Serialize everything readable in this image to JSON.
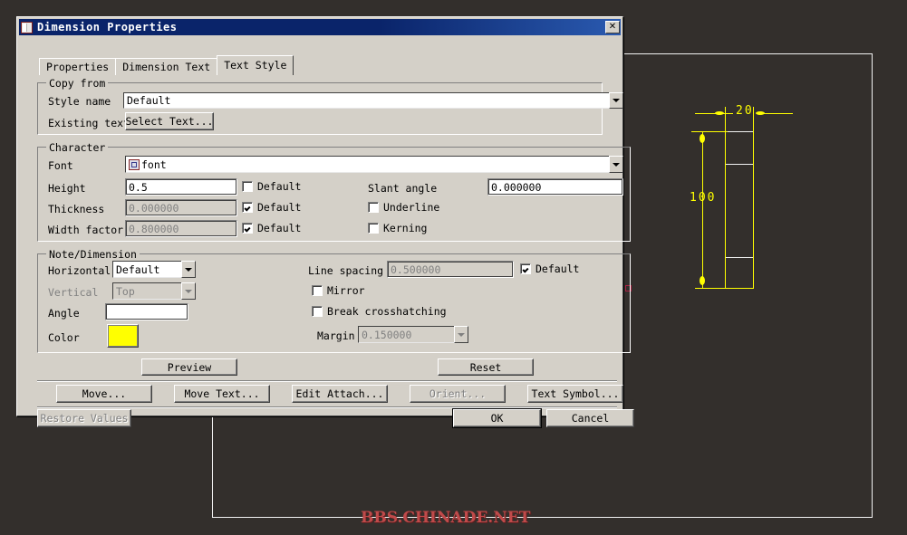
{
  "dialog": {
    "title": "Dimension Properties",
    "close_label": "✕",
    "tabs": [
      {
        "label": "Properties",
        "active": false
      },
      {
        "label": "Dimension Text",
        "active": false
      },
      {
        "label": "Text Style",
        "active": true
      }
    ],
    "copy_from": {
      "group_label": "Copy from",
      "style_name_label": "Style name",
      "style_name_value": "Default",
      "existing_text_label": "Existing text",
      "select_text_button": "Select Text..."
    },
    "character": {
      "group_label": "Character",
      "font_label": "Font",
      "font_value": "font",
      "height_label": "Height",
      "height_value": "0.5",
      "height_default_label": "Default",
      "height_default_checked": false,
      "thickness_label": "Thickness",
      "thickness_value": "0.000000",
      "thickness_default_label": "Default",
      "thickness_default_checked": true,
      "width_factor_label": "Width factor",
      "width_factor_value": "0.800000",
      "width_factor_default_label": "Default",
      "width_factor_default_checked": true,
      "slant_angle_label": "Slant angle",
      "slant_angle_value": "0.000000",
      "underline_label": "Underline",
      "underline_checked": false,
      "kerning_label": "Kerning",
      "kerning_checked": false
    },
    "note_dimension": {
      "group_label": "Note/Dimension",
      "horizontal_label": "Horizontal",
      "horizontal_value": "Default",
      "vertical_label": "Vertical",
      "vertical_value": "Top",
      "angle_label": "Angle",
      "angle_value": "",
      "color_label": "Color",
      "color_value": "#ffff00",
      "line_spacing_label": "Line spacing",
      "line_spacing_value": "0.500000",
      "line_spacing_default_label": "Default",
      "line_spacing_default_checked": true,
      "mirror_label": "Mirror",
      "mirror_checked": false,
      "break_crosshatching_label": "Break crosshatching",
      "break_crosshatching_checked": false,
      "margin_label": "Margin",
      "margin_value": "0.150000"
    },
    "actions": {
      "preview": "Preview",
      "reset": "Reset",
      "move": "Move...",
      "move_text": "Move Text...",
      "edit_attach": "Edit Attach...",
      "orient": "Orient...",
      "text_symbol": "Text Symbol...",
      "restore_values": "Restore Values",
      "ok": "OK",
      "cancel": "Cancel"
    }
  },
  "cad": {
    "dimension_width": "20",
    "dimension_height": "100",
    "watermark": "BBS.CHINADE.NET",
    "entity_color": "#ffff00",
    "geometry_color": "#f2f2f2",
    "background_color": "#332f2c"
  }
}
